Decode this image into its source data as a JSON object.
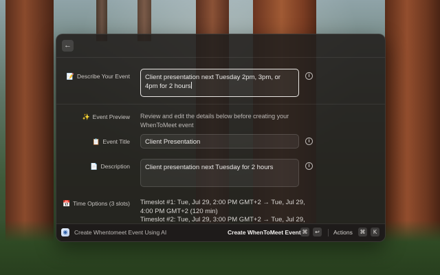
{
  "header": {
    "back_glyph": "←"
  },
  "form": {
    "describe": {
      "icon": "📝",
      "label": "Describe Your Event",
      "value": "Client presentation next Tuesday 2pm, 3pm, or 4pm for 2 hours"
    },
    "preview": {
      "icon": "✨",
      "label": "Event Preview",
      "text": "Review and edit the details below before creating your WhenToMeet event"
    },
    "title": {
      "icon": "📋",
      "label": "Event Title",
      "value": "Client Presentation"
    },
    "description": {
      "icon": "📄",
      "label": "Description",
      "value": "Client presentation next Tuesday for 2 hours"
    },
    "time_options": {
      "icon": "📅",
      "label": "Time Options (3 slots)",
      "slots": [
        "Timeslot #1: Tue, Jul 29, 2:00 PM GMT+2 → Tue, Jul 29, 4:00 PM GMT+2 (120 min)",
        "Timeslot #2: Tue, Jul 29, 3:00 PM GMT+2 → Tue, Jul 29,"
      ]
    },
    "info_glyph": "i"
  },
  "footer": {
    "app_icon_glyph": "◉",
    "title": "Create Whentomeet Event Using AI",
    "primary_action": "Create WhenToMeet Event",
    "primary_keys": [
      "⌘",
      "↩"
    ],
    "actions_label": "Actions",
    "actions_keys": [
      "⌘",
      "K"
    ]
  }
}
